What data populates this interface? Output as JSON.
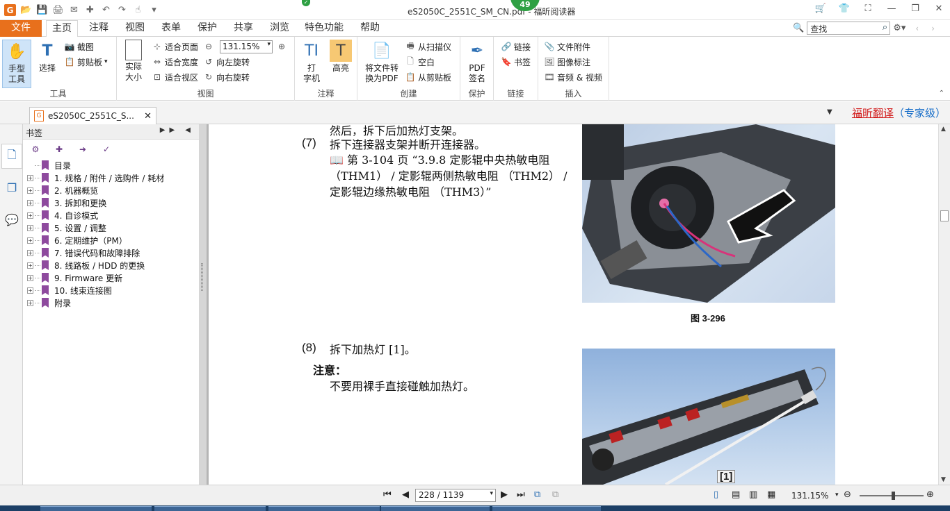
{
  "window": {
    "title": "eS2050C_2551C_SM_CN.pdf - 福昕阅读器",
    "badge": "49",
    "badge_g": "✓"
  },
  "tabs": [
    "文件",
    "主页",
    "注释",
    "视图",
    "表单",
    "保护",
    "共享",
    "浏览",
    "特色功能",
    "帮助"
  ],
  "search": {
    "placeholder": "查找"
  },
  "ribbon": {
    "tools_group": "工具",
    "hand": "手型\n工具",
    "select": "选择",
    "screenshot": "截图",
    "clipboard": "剪贴板",
    "view_group": "视图",
    "actual_size": "实际\n大小",
    "fit_page": "适合页面",
    "fit_width": "适合宽度",
    "fit_visible": "适合视区",
    "zoom_value": "131.15%",
    "rotate_left": "向左旋转",
    "rotate_right": "向右旋转",
    "comment_group": "注释",
    "typewriter": "打\n字机",
    "highlight": "高亮",
    "create_group": "创建",
    "convert_pdf": "将文件转\n换为PDF",
    "from_scanner": "从扫描仪",
    "blank": "空白",
    "from_clipboard": "从剪贴板",
    "protect_group": "保护",
    "pdf_sign": "PDF\n签名",
    "links_group": "链接",
    "link": "链接",
    "bookmark": "书签",
    "insert_group": "插入",
    "file_attach": "文件附件",
    "image_annot": "图像标注",
    "audio_video": "音频 & 视频"
  },
  "doctab": {
    "label": "eS2050C_2551C_S..."
  },
  "translate": {
    "brand": "福昕翻译",
    "level": "（专家级）"
  },
  "bookmarks": {
    "header": "书签",
    "items": [
      {
        "label": "目录",
        "expandable": false
      },
      {
        "label": "1. 规格 / 附件 / 选购件 / 耗材",
        "expandable": true
      },
      {
        "label": "2. 机器概览",
        "expandable": true
      },
      {
        "label": "3. 拆卸和更换",
        "expandable": true
      },
      {
        "label": "4. 自诊模式",
        "expandable": true
      },
      {
        "label": "5. 设置 / 调整",
        "expandable": true
      },
      {
        "label": "6. 定期维护（PM）",
        "expandable": true
      },
      {
        "label": "7. 错误代码和故障排除",
        "expandable": true
      },
      {
        "label": "8. 线路板 / HDD 的更换",
        "expandable": true
      },
      {
        "label": "9. Firmware 更新",
        "expandable": true
      },
      {
        "label": "10. 线束连接图",
        "expandable": true
      },
      {
        "label": "附录",
        "expandable": true
      }
    ]
  },
  "document": {
    "line_top": "然后，拆下后加热灯支架。",
    "step7_num": "(7)",
    "step7_text": "拆下连接器支架并断开连接器。",
    "ref_line1": "📖 第 3-104 页 “3.9.8 定影辊中央热敏电阻",
    "ref_line2": "（THM1） / 定影辊两侧热敏电阻 （THM2） /",
    "ref_line3": "定影辊边缘热敏电阻 （THM3）”",
    "fig_caption": "图 3-296",
    "step8_num": "(8)",
    "step8_text": "拆下加热灯 [1]。",
    "note_title": "注意：",
    "note_text": "不要用裸手直接碰触加热灯。",
    "photo2_label": "[1]"
  },
  "statusbar": {
    "page": "228 / 1139",
    "zoom": "131.15%"
  },
  "colors": {
    "accent": "#e8701c",
    "bookmark_flag": "#8e4a9e",
    "translate_red": "#d21d1d",
    "translate_blue": "#1a6fc9"
  }
}
